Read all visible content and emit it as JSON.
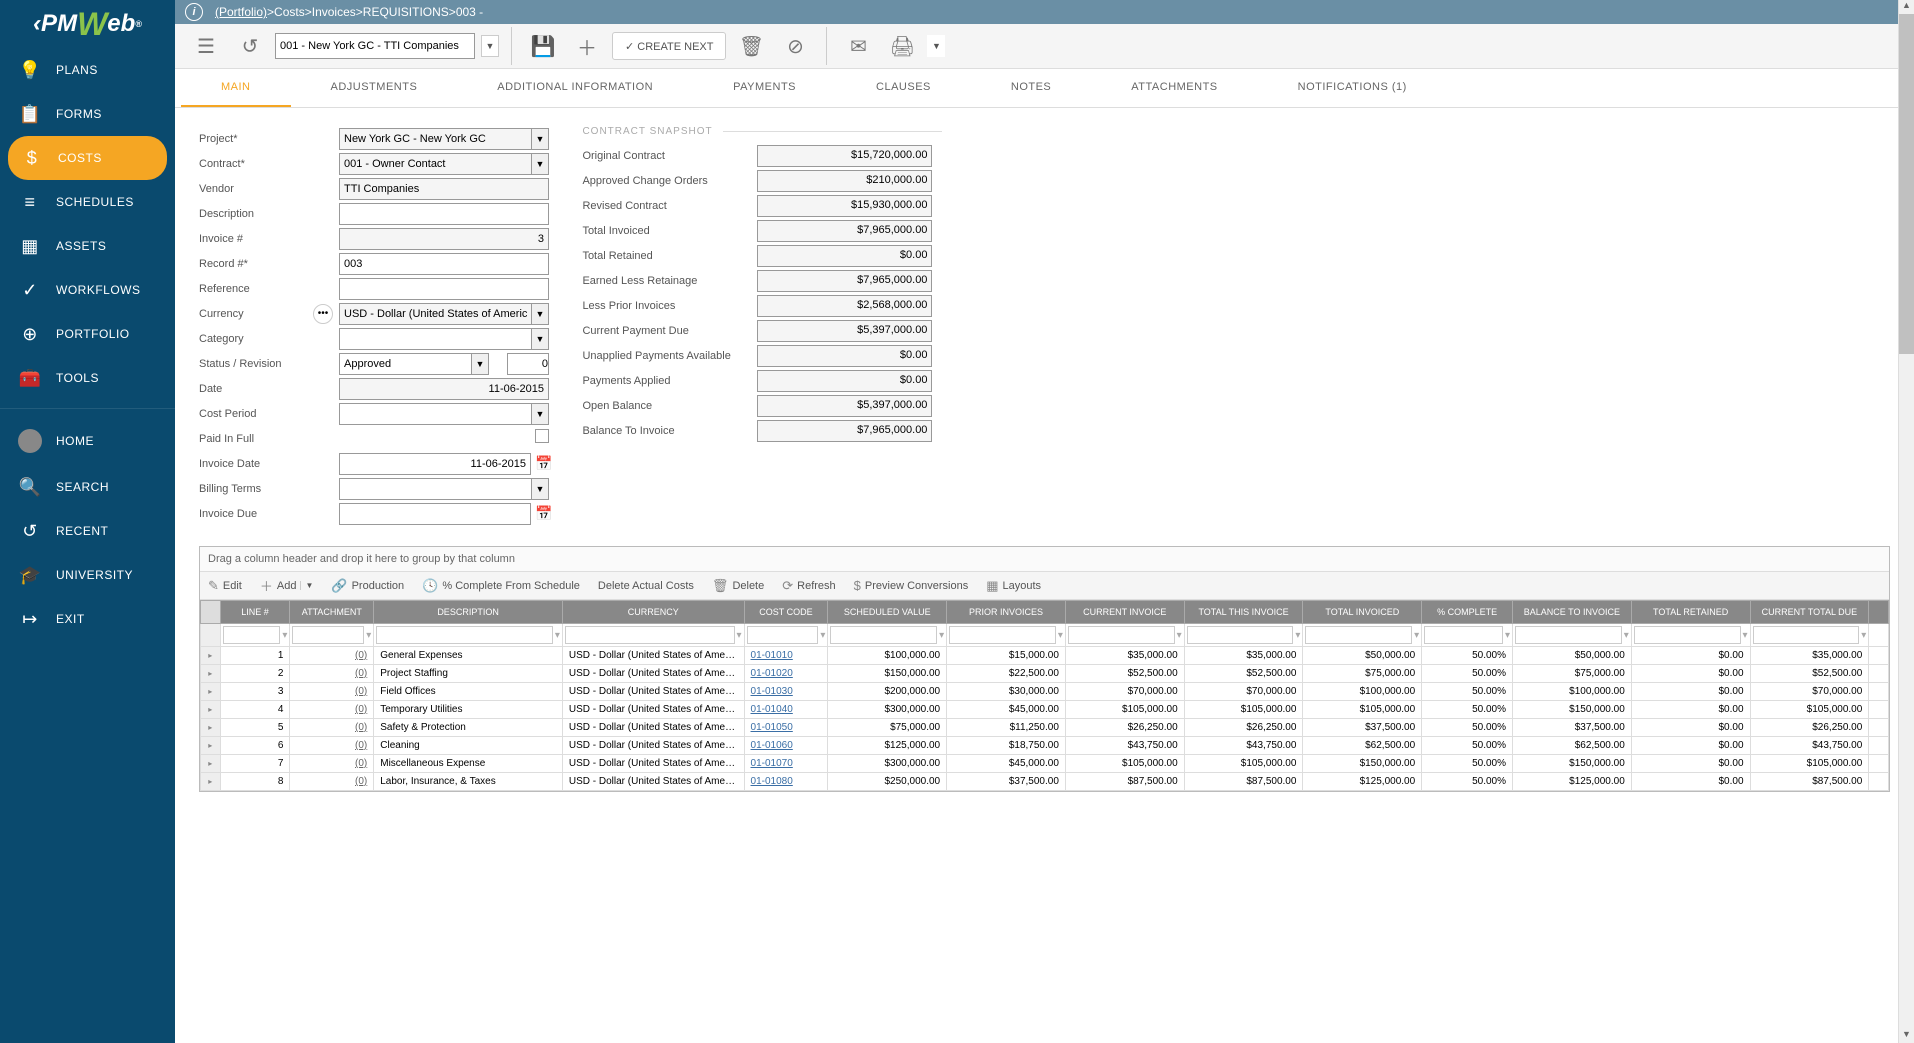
{
  "breadcrumb": {
    "portfolio": "(Portfolio)",
    "sep": " > ",
    "costs": "Costs",
    "invoices": "Invoices",
    "requisitions": "REQUISITIONS",
    "record": "003 -"
  },
  "sidebar": {
    "items": [
      {
        "label": "PLANS",
        "icon": "💡"
      },
      {
        "label": "FORMS",
        "icon": "📋"
      },
      {
        "label": "COSTS",
        "icon": "$",
        "active": true
      },
      {
        "label": "SCHEDULES",
        "icon": "≡"
      },
      {
        "label": "ASSETS",
        "icon": "▦"
      },
      {
        "label": "WORKFLOWS",
        "icon": "✓"
      },
      {
        "label": "PORTFOLIO",
        "icon": "⊕"
      },
      {
        "label": "TOOLS",
        "icon": "🧰"
      }
    ],
    "lower": [
      {
        "label": "HOME",
        "avatar": true
      },
      {
        "label": "SEARCH",
        "icon": "🔍"
      },
      {
        "label": "RECENT",
        "icon": "↺"
      },
      {
        "label": "UNIVERSITY",
        "icon": "🎓"
      },
      {
        "label": "EXIT",
        "icon": "↦"
      }
    ]
  },
  "toolbar": {
    "context": "001 - New York GC - TTI Companies",
    "create_next": "CREATE NEXT"
  },
  "tabs": [
    {
      "label": "MAIN",
      "active": true
    },
    {
      "label": "ADJUSTMENTS"
    },
    {
      "label": "ADDITIONAL INFORMATION"
    },
    {
      "label": "PAYMENTS"
    },
    {
      "label": "CLAUSES"
    },
    {
      "label": "NOTES"
    },
    {
      "label": "ATTACHMENTS"
    },
    {
      "label": "NOTIFICATIONS (1)"
    }
  ],
  "form": {
    "project_label": "Project*",
    "project": "New York GC - New York GC",
    "contract_label": "Contract*",
    "contract": "001 - Owner Contact",
    "vendor_label": "Vendor",
    "vendor": "TTI Companies",
    "description_label": "Description",
    "description": "",
    "invoice_num_label": "Invoice #",
    "invoice_num": "3",
    "record_label": "Record #*",
    "record": "003",
    "reference_label": "Reference",
    "reference": "",
    "currency_label": "Currency",
    "currency": "USD - Dollar (United States of America)",
    "category_label": "Category",
    "category": "",
    "status_label": "Status / Revision",
    "status": "Approved",
    "revision": "0",
    "date_label": "Date",
    "date": "11-06-2015",
    "costperiod_label": "Cost Period",
    "costperiod": "",
    "paidinfull_label": "Paid In Full",
    "invoicedate_label": "Invoice Date",
    "invoicedate": "11-06-2015",
    "billingterms_label": "Billing Terms",
    "billingterms": "",
    "invoicedue_label": "Invoice Due",
    "invoicedue": ""
  },
  "snapshot": {
    "title": "CONTRACT SNAPSHOT",
    "rows": [
      {
        "label": "Original Contract",
        "val": "$15,720,000.00"
      },
      {
        "label": "Approved Change Orders",
        "val": "$210,000.00"
      },
      {
        "label": "Revised Contract",
        "val": "$15,930,000.00"
      },
      {
        "label": "Total Invoiced",
        "val": "$7,965,000.00"
      },
      {
        "label": "Total Retained",
        "val": "$0.00"
      },
      {
        "label": "Earned Less Retainage",
        "val": "$7,965,000.00"
      },
      {
        "label": "Less Prior Invoices",
        "val": "$2,568,000.00"
      },
      {
        "label": "Current Payment Due",
        "val": "$5,397,000.00"
      },
      {
        "label": "Unapplied Payments Available",
        "val": "$0.00"
      },
      {
        "label": "Payments Applied",
        "val": "$0.00"
      },
      {
        "label": "Open Balance",
        "val": "$5,397,000.00"
      },
      {
        "label": "Balance To Invoice",
        "val": "$7,965,000.00"
      }
    ]
  },
  "grid": {
    "group_hint": "Drag a column header and drop it here to group by that column",
    "toolbar": {
      "edit": "Edit",
      "add": "Add",
      "production": "Production",
      "pct": "% Complete From Schedule",
      "delactual": "Delete Actual Costs",
      "delete": "Delete",
      "refresh": "Refresh",
      "preview": "Preview Conversions",
      "layouts": "Layouts"
    },
    "headers": [
      "LINE #",
      "ATTACHMENT",
      "DESCRIPTION",
      "CURRENCY",
      "COST CODE",
      "SCHEDULED VALUE",
      "PRIOR INVOICES",
      "CURRENT INVOICE",
      "TOTAL THIS INVOICE",
      "TOTAL INVOICED",
      "% COMPLETE",
      "BALANCE TO INVOICE",
      "TOTAL RETAINED",
      "CURRENT TOTAL DUE"
    ],
    "rows": [
      {
        "line": "1",
        "attach": "(0)",
        "desc": "General Expenses",
        "curr": "USD - Dollar (United States of America)",
        "code": "01-01010",
        "sched": "$100,000.00",
        "prior": "$15,000.00",
        "curr_inv": "$35,000.00",
        "tot_this": "$35,000.00",
        "tot_inv": "$50,000.00",
        "pct": "50.00%",
        "bal": "$50,000.00",
        "ret": "$0.00",
        "due": "$35,000.00"
      },
      {
        "line": "2",
        "attach": "(0)",
        "desc": "Project Staffing",
        "curr": "USD - Dollar (United States of America)",
        "code": "01-01020",
        "sched": "$150,000.00",
        "prior": "$22,500.00",
        "curr_inv": "$52,500.00",
        "tot_this": "$52,500.00",
        "tot_inv": "$75,000.00",
        "pct": "50.00%",
        "bal": "$75,000.00",
        "ret": "$0.00",
        "due": "$52,500.00"
      },
      {
        "line": "3",
        "attach": "(0)",
        "desc": "Field Offices",
        "curr": "USD - Dollar (United States of America)",
        "code": "01-01030",
        "sched": "$200,000.00",
        "prior": "$30,000.00",
        "curr_inv": "$70,000.00",
        "tot_this": "$70,000.00",
        "tot_inv": "$100,000.00",
        "pct": "50.00%",
        "bal": "$100,000.00",
        "ret": "$0.00",
        "due": "$70,000.00"
      },
      {
        "line": "4",
        "attach": "(0)",
        "desc": "Temporary Utilities",
        "curr": "USD - Dollar (United States of America)",
        "code": "01-01040",
        "sched": "$300,000.00",
        "prior": "$45,000.00",
        "curr_inv": "$105,000.00",
        "tot_this": "$105,000.00",
        "tot_inv": "$105,000.00",
        "pct": "50.00%",
        "bal": "$150,000.00",
        "ret": "$0.00",
        "due": "$105,000.00"
      },
      {
        "line": "5",
        "attach": "(0)",
        "desc": "Safety & Protection",
        "curr": "USD - Dollar (United States of America)",
        "code": "01-01050",
        "sched": "$75,000.00",
        "prior": "$11,250.00",
        "curr_inv": "$26,250.00",
        "tot_this": "$26,250.00",
        "tot_inv": "$37,500.00",
        "pct": "50.00%",
        "bal": "$37,500.00",
        "ret": "$0.00",
        "due": "$26,250.00"
      },
      {
        "line": "6",
        "attach": "(0)",
        "desc": "Cleaning",
        "curr": "USD - Dollar (United States of America)",
        "code": "01-01060",
        "sched": "$125,000.00",
        "prior": "$18,750.00",
        "curr_inv": "$43,750.00",
        "tot_this": "$43,750.00",
        "tot_inv": "$62,500.00",
        "pct": "50.00%",
        "bal": "$62,500.00",
        "ret": "$0.00",
        "due": "$43,750.00"
      },
      {
        "line": "7",
        "attach": "(0)",
        "desc": "Miscellaneous Expense",
        "curr": "USD - Dollar (United States of America)",
        "code": "01-01070",
        "sched": "$300,000.00",
        "prior": "$45,000.00",
        "curr_inv": "$105,000.00",
        "tot_this": "$105,000.00",
        "tot_inv": "$150,000.00",
        "pct": "50.00%",
        "bal": "$150,000.00",
        "ret": "$0.00",
        "due": "$105,000.00"
      },
      {
        "line": "8",
        "attach": "(0)",
        "desc": "Labor, Insurance, & Taxes",
        "curr": "USD - Dollar (United States of America)",
        "code": "01-01080",
        "sched": "$250,000.00",
        "prior": "$37,500.00",
        "curr_inv": "$87,500.00",
        "tot_this": "$87,500.00",
        "tot_inv": "$125,000.00",
        "pct": "50.00%",
        "bal": "$125,000.00",
        "ret": "$0.00",
        "due": "$87,500.00"
      }
    ]
  }
}
